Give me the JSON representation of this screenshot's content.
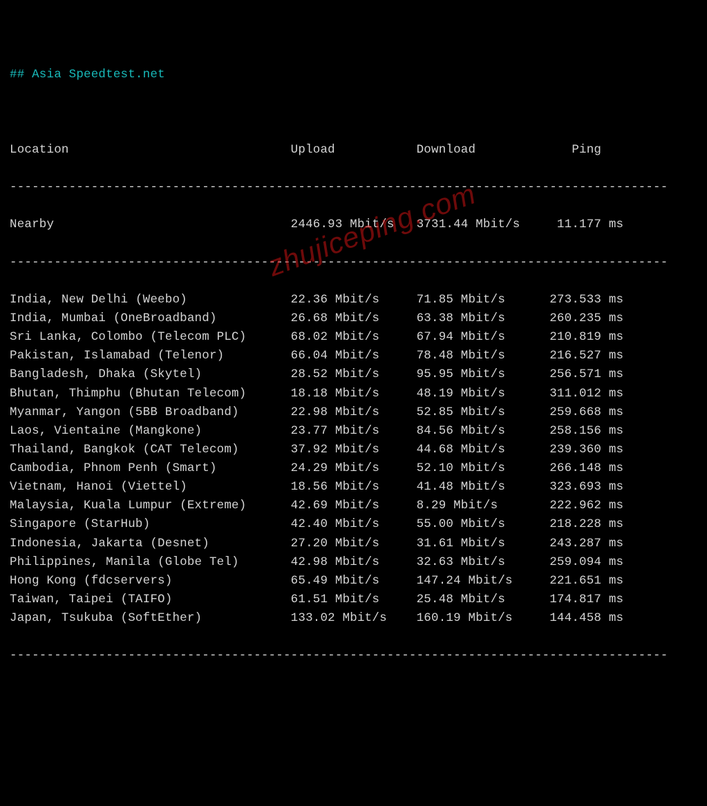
{
  "title": "## Asia Speedtest.net",
  "headers": {
    "location": "Location",
    "upload": "Upload",
    "download": "Download",
    "ping": "Ping"
  },
  "nearby": {
    "location": "Nearby",
    "upload": "2446.93 Mbit/s",
    "download": "3731.44 Mbit/s",
    "ping": "11.177 ms"
  },
  "rows": [
    {
      "location": "India, New Delhi (Weebo)",
      "upload": "22.36 Mbit/s",
      "download": "71.85 Mbit/s",
      "ping": "273.533 ms"
    },
    {
      "location": "India, Mumbai (OneBroadband)",
      "upload": "26.68 Mbit/s",
      "download": "63.38 Mbit/s",
      "ping": "260.235 ms"
    },
    {
      "location": "Sri Lanka, Colombo (Telecom PLC)",
      "upload": "68.02 Mbit/s",
      "download": "67.94 Mbit/s",
      "ping": "210.819 ms"
    },
    {
      "location": "Pakistan, Islamabad (Telenor)",
      "upload": "66.04 Mbit/s",
      "download": "78.48 Mbit/s",
      "ping": "216.527 ms"
    },
    {
      "location": "Bangladesh, Dhaka (Skytel)",
      "upload": "28.52 Mbit/s",
      "download": "95.95 Mbit/s",
      "ping": "256.571 ms"
    },
    {
      "location": "Bhutan, Thimphu (Bhutan Telecom)",
      "upload": "18.18 Mbit/s",
      "download": "48.19 Mbit/s",
      "ping": "311.012 ms"
    },
    {
      "location": "Myanmar, Yangon (5BB Broadband)",
      "upload": "22.98 Mbit/s",
      "download": "52.85 Mbit/s",
      "ping": "259.668 ms"
    },
    {
      "location": "Laos, Vientaine (Mangkone)",
      "upload": "23.77 Mbit/s",
      "download": "84.56 Mbit/s",
      "ping": "258.156 ms"
    },
    {
      "location": "Thailand, Bangkok (CAT Telecom)",
      "upload": "37.92 Mbit/s",
      "download": "44.68 Mbit/s",
      "ping": "239.360 ms"
    },
    {
      "location": "Cambodia, Phnom Penh (Smart)",
      "upload": "24.29 Mbit/s",
      "download": "52.10 Mbit/s",
      "ping": "266.148 ms"
    },
    {
      "location": "Vietnam, Hanoi (Viettel)",
      "upload": "18.56 Mbit/s",
      "download": "41.48 Mbit/s",
      "ping": "323.693 ms"
    },
    {
      "location": "Malaysia, Kuala Lumpur (Extreme)",
      "upload": "42.69 Mbit/s",
      "download": "8.29 Mbit/s",
      "ping": "222.962 ms"
    },
    {
      "location": "Singapore (StarHub)",
      "upload": "42.40 Mbit/s",
      "download": "55.00 Mbit/s",
      "ping": "218.228 ms"
    },
    {
      "location": "Indonesia, Jakarta (Desnet)",
      "upload": "27.20 Mbit/s",
      "download": "31.61 Mbit/s",
      "ping": "243.287 ms"
    },
    {
      "location": "Philippines, Manila (Globe Tel)",
      "upload": "42.98 Mbit/s",
      "download": "32.63 Mbit/s",
      "ping": "259.094 ms"
    },
    {
      "location": "Hong Kong (fdcservers)",
      "upload": "65.49 Mbit/s",
      "download": "147.24 Mbit/s",
      "ping": "221.651 ms"
    },
    {
      "location": "Taiwan, Taipei (TAIFO)",
      "upload": "61.51 Mbit/s",
      "download": "25.48 Mbit/s",
      "ping": "174.817 ms"
    },
    {
      "location": "Japan, Tsukuba (SoftEther)",
      "upload": "133.02 Mbit/s",
      "download": "160.19 Mbit/s",
      "ping": "144.458 ms"
    }
  ],
  "watermark": "zhujiceping.com"
}
